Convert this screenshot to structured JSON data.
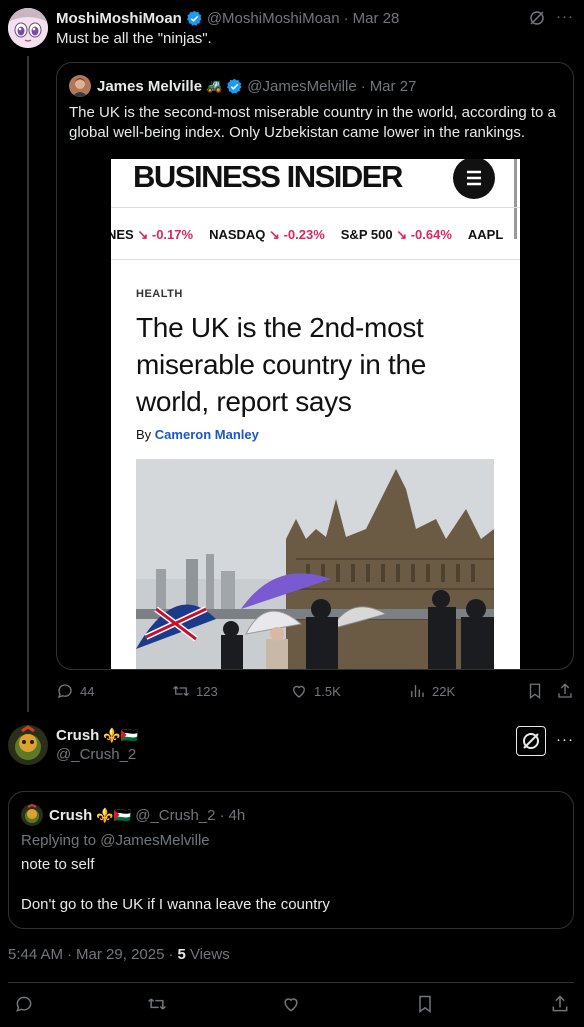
{
  "post": {
    "author_name": "MoshiMoshiMoan",
    "handle": "@MoshiMoshiMoan",
    "sep": "·",
    "date": "Mar 28",
    "text": "Must be all the \"ninjas\".",
    "more": "···"
  },
  "quoted": {
    "author_name": "James Melville",
    "emoji": "🚜",
    "handle": "@JamesMelville",
    "sep": "·",
    "date": "Mar 27",
    "text": "The UK is the second-most miserable country in the world, according to a global well-being index. Only Uzbekistan came lower in the rankings.",
    "image": {
      "brand": "BUSINESS INSIDER",
      "ticker": [
        {
          "name": "NES",
          "value": "-0.17%"
        },
        {
          "name": "NASDAQ",
          "value": "-0.23%"
        },
        {
          "name": "S&P 500",
          "value": "-0.64%"
        },
        {
          "name": "AAPL",
          "value": ""
        }
      ],
      "section": "HEALTH",
      "headline": "The UK is the 2nd-most miserable country in the world, report says",
      "byline_prefix": "By",
      "byline_author": "Cameron Manley"
    }
  },
  "actions": {
    "replies": "44",
    "reposts": "123",
    "likes": "1.5K",
    "views": "22K"
  },
  "reply": {
    "author_name": "Crush",
    "emoji": "⚜️🇵🇸",
    "handle": "@_Crush_2",
    "more": "···"
  },
  "reply_quote": {
    "author_name": "Crush",
    "emoji": "⚜️🇵🇸",
    "handle": "@_Crush_2",
    "sep": "·",
    "time": "4h",
    "replying_prefix": "Replying to",
    "replying_handle": "@JamesMelville",
    "line1": "note to self",
    "line2": "Don't go to the UK if I wanna leave the country"
  },
  "meta": {
    "time": "5:44 AM",
    "sep1": "·",
    "date": "Mar 29, 2025",
    "sep2": "·",
    "views_count": "5",
    "views_label": "Views"
  },
  "colors": {
    "background": "#000000",
    "text": "#e7e9ea",
    "muted": "#71767b",
    "border": "#2f3336",
    "verified": "#1d9bf0",
    "ticker_red": "#e0245e"
  }
}
